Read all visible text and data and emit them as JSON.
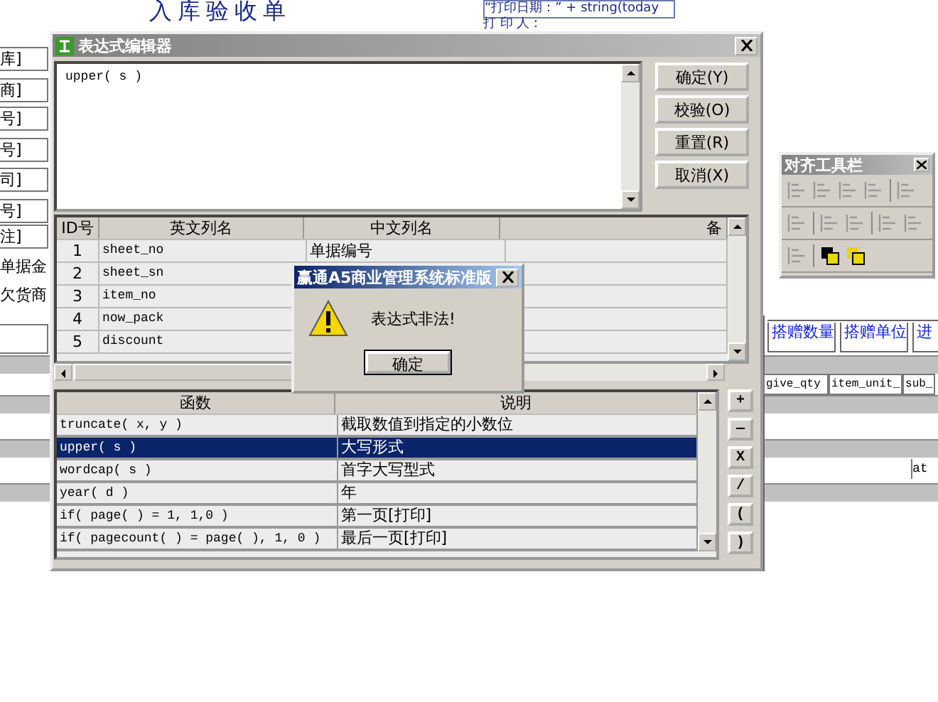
{
  "report": {
    "title": "入库验收单",
    "left_labels": [
      "库]",
      "商]",
      "号]",
      "号]",
      "司]",
      "号]",
      "注]",
      "单据金",
      "欠货商"
    ],
    "print_date_field": "“打印日期：” + string(today",
    "printer_field": "打 印 人：",
    "column_headers": [
      "搭赠数量",
      "搭赠单位",
      "进"
    ],
    "field_cells": [
      "give_qty",
      "item_unit_",
      "sub_"
    ],
    "cut_cell": "at"
  },
  "expression_editor": {
    "title": "表达式编辑器",
    "expression": "upper( s )",
    "buttons": [
      "确定(Y)",
      "校验(O)",
      "重置(R)",
      "取消(X)"
    ],
    "columns_table": {
      "headers": [
        "ID号",
        "英文列名",
        "中文列名",
        "备"
      ],
      "rows": [
        {
          "id": "1",
          "name": "sheet_no",
          "label": "单据编号"
        },
        {
          "id": "2",
          "name": "sheet_sn",
          "label": ""
        },
        {
          "id": "3",
          "name": "item_no",
          "label": ""
        },
        {
          "id": "4",
          "name": "now_pack",
          "label": ""
        },
        {
          "id": "5",
          "name": "discount",
          "label": ""
        }
      ]
    },
    "functions_table": {
      "headers": [
        "函数",
        "说明"
      ],
      "rows": [
        {
          "function": "truncate( x, y )",
          "description": "截取数值到指定的小数位",
          "selected": false
        },
        {
          "function": "upper( s )",
          "description": "大写形式",
          "selected": true
        },
        {
          "function": "wordcap( s )",
          "description": "首字大写型式",
          "selected": false
        },
        {
          "function": "year( d )",
          "description": "年",
          "selected": false
        },
        {
          "function": "if( page( ) = 1, 1,0 )",
          "description": "第一页[打印]",
          "selected": false
        },
        {
          "function": "if( pagecount( ) = page( ), 1, 0 )",
          "description": "最后一页[打印]",
          "selected": false
        }
      ]
    },
    "operators": [
      "+",
      "—",
      "X",
      "/",
      "(",
      ")"
    ]
  },
  "message_box": {
    "title": "赢通A5商业管理系统标准版",
    "message": "表达式非法!",
    "button": "确定"
  },
  "align_toolbar": {
    "title": "对齐工具栏"
  }
}
